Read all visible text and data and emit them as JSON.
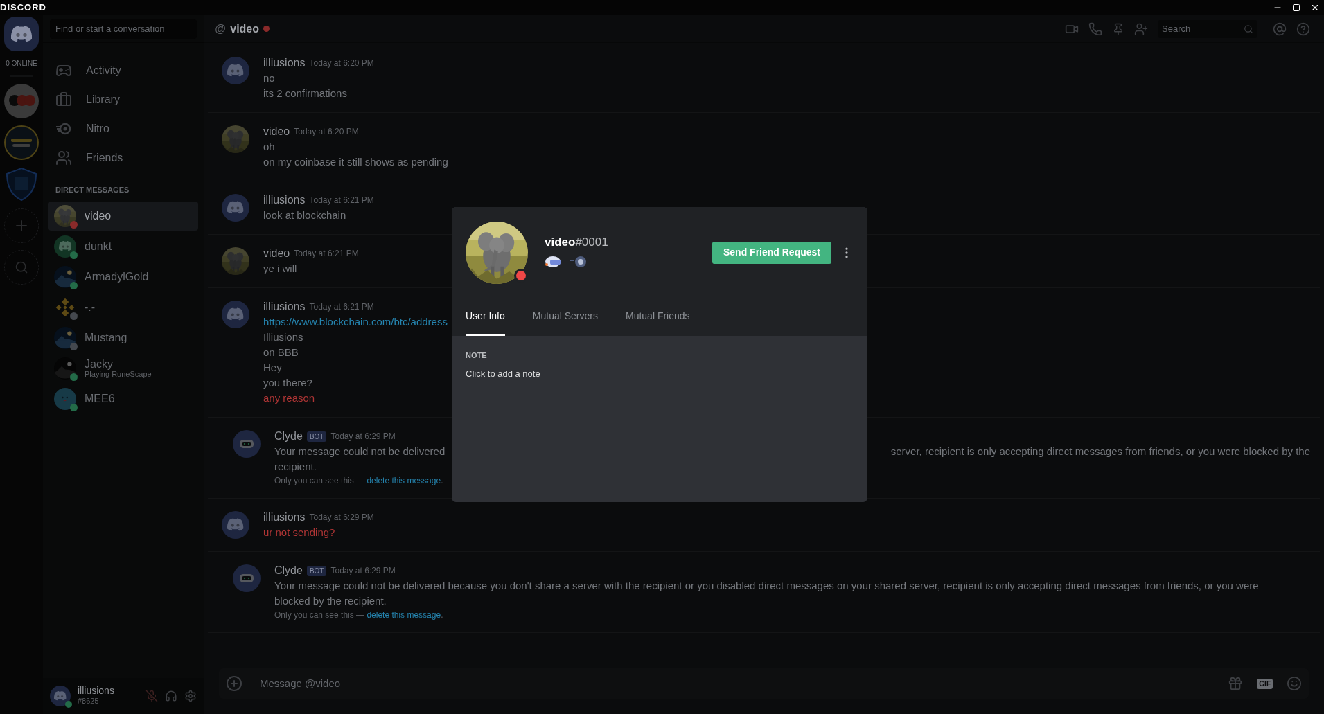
{
  "app_title": "DISCORD",
  "servers": {
    "online_count": "0 ONLINE"
  },
  "search": {
    "placeholder": "Find or start a conversation"
  },
  "nav": [
    {
      "label": "Activity",
      "kind": "activity"
    },
    {
      "label": "Library",
      "kind": "library"
    },
    {
      "label": "Nitro",
      "kind": "nitro"
    },
    {
      "label": "Friends",
      "kind": "friends"
    }
  ],
  "dm_header": "DIRECT MESSAGES",
  "dms": [
    {
      "name": "video",
      "avatar": {
        "kind": "elephant"
      },
      "color": "#8a2a2a",
      "selected": true
    },
    {
      "name": "dunkt",
      "avatar": {
        "kind": "green"
      },
      "color": "#236b48",
      "selected": false
    },
    {
      "name": "ArmadylGold",
      "avatar": {
        "kind": "night"
      },
      "color": "#236b48",
      "selected": false
    },
    {
      "name": "-.-",
      "avatar": {
        "kind": "diamond"
      },
      "color": "#44484e",
      "selected": false
    },
    {
      "name": "Mustang",
      "avatar": {
        "kind": "night"
      },
      "color": "#44484e",
      "selected": false
    },
    {
      "name": "Jacky",
      "activity": "Playing RuneScape",
      "avatar": {
        "kind": "dark"
      },
      "color": "#236b48",
      "selected": false
    },
    {
      "name": "MEE6",
      "avatar": {
        "kind": "face"
      },
      "color": "#236b48",
      "selected": false
    }
  ],
  "user_panel": {
    "name": "illiusions",
    "tag": "#8625"
  },
  "channel": {
    "prefix": "@",
    "name": "video",
    "status": {
      "color": "#8a2a2a"
    },
    "search_placeholder": "Search"
  },
  "messages": [
    {
      "kind": "user",
      "author": "illiusions",
      "avatar": {
        "kind": "blue"
      },
      "time": "Today at 6:20 PM",
      "lines": [
        {
          "kind": "text",
          "text": "no"
        },
        {
          "kind": "text",
          "text": "its 2 confirmations"
        }
      ]
    },
    {
      "kind": "user",
      "author": "video",
      "avatar": {
        "kind": "elephant"
      },
      "time": "Today at 6:20 PM",
      "lines": [
        {
          "kind": "text",
          "text": "oh"
        },
        {
          "kind": "text",
          "text": "on my coinbase it still shows as pending"
        }
      ]
    },
    {
      "kind": "user",
      "author": "illiusions",
      "avatar": {
        "kind": "blue"
      },
      "time": "Today at 6:21 PM",
      "lines": [
        {
          "kind": "text",
          "text": "look at blockchain"
        }
      ]
    },
    {
      "kind": "user",
      "author": "video",
      "avatar": {
        "kind": "elephant"
      },
      "time": "Today at 6:21 PM",
      "lines": [
        {
          "kind": "text",
          "text": "ye i will"
        }
      ]
    },
    {
      "kind": "user",
      "author": "illiusions",
      "avatar": {
        "kind": "blue"
      },
      "time": "Today at 6:21 PM",
      "lines": [
        {
          "kind": "link",
          "text": "https://www.blockchain.com/btc/address"
        },
        {
          "kind": "text",
          "text": "Illiusions"
        },
        {
          "kind": "text",
          "text": "on BBB"
        },
        {
          "kind": "text",
          "text": "Hey"
        },
        {
          "kind": "text",
          "text": "you there?"
        },
        {
          "kind": "failed",
          "text": "any reason"
        }
      ]
    },
    {
      "kind": "bot",
      "author": "Clyde",
      "tag": "BOT",
      "avatar": {
        "kind": "robot"
      },
      "time": "Today at 6:29 PM",
      "lines": [
        {
          "kind": "split",
          "left": "Your message could not be delivered",
          "right": "server, recipient is only accepting direct messages from friends, or you were blocked by the"
        },
        {
          "kind": "text",
          "text": "recipient."
        }
      ],
      "note": "Only you can see this — ",
      "note_link": "delete this message",
      "note_end": "."
    },
    {
      "kind": "user",
      "author": "illiusions",
      "avatar": {
        "kind": "blue"
      },
      "time": "Today at 6:29 PM",
      "lines": [
        {
          "kind": "failed",
          "text": "ur not sending?"
        }
      ]
    },
    {
      "kind": "bot",
      "author": "Clyde",
      "tag": "BOT",
      "avatar": {
        "kind": "robot"
      },
      "time": "Today at 6:29 PM",
      "lines": [
        {
          "kind": "text",
          "text": "Your message could not be delivered because you don't share a server with the recipient or you disabled direct messages on your shared server, recipient is only accepting direct messages from friends, or you were blocked by the recipient."
        }
      ],
      "note": "Only you can see this — ",
      "note_link": "delete this message",
      "note_end": "."
    }
  ],
  "composer": {
    "placeholder": "Message @video",
    "gif_label": "GIF"
  },
  "profile": {
    "username": "video",
    "discriminator": "#0001",
    "status": {
      "color": "#f04747"
    },
    "button": "Send Friend Request",
    "tabs": [
      {
        "label": "User Info",
        "selected": true
      },
      {
        "label": "Mutual Servers",
        "selected": false
      },
      {
        "label": "Mutual Friends",
        "selected": false
      }
    ],
    "note_label": "NOTE",
    "note_placeholder": "Click to add a note"
  }
}
